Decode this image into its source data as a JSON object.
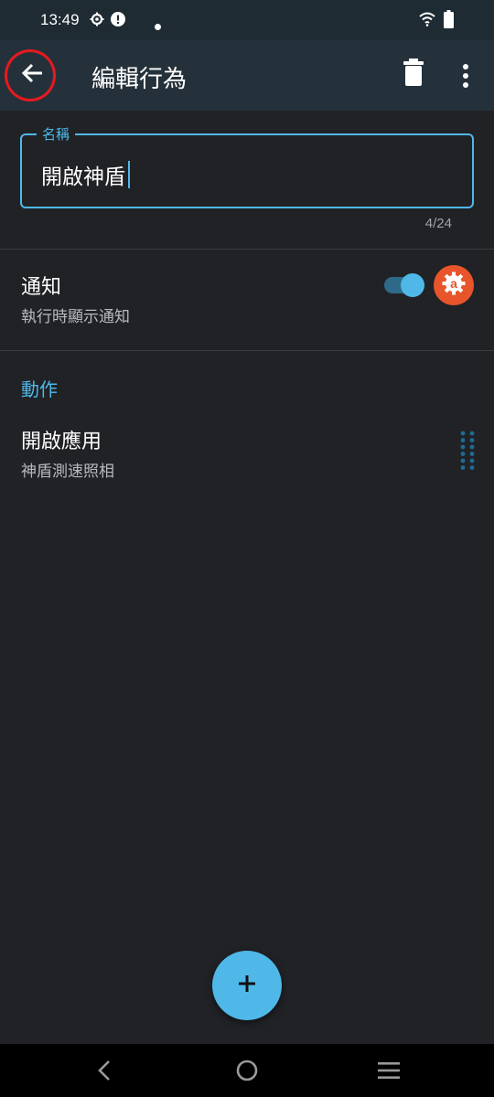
{
  "status_bar": {
    "time": "13:49",
    "icons": [
      "settings-gear-icon",
      "alert-icon",
      "dot-icon",
      "wifi-icon",
      "battery-icon"
    ]
  },
  "app_bar": {
    "title": "編輯行為",
    "icons": [
      "back-arrow-icon",
      "delete-icon",
      "more-vert-icon"
    ]
  },
  "name_field": {
    "label": "名稱",
    "value": "開啟神盾",
    "counter": "4/24"
  },
  "notification": {
    "title": "通知",
    "subtitle": "執行時顯示通知",
    "enabled": true,
    "badge_icon": "automation-a-icon"
  },
  "actions_section": {
    "heading": "動作",
    "items": [
      {
        "title": "開啟應用",
        "subtitle": "神盾測速照相",
        "handle_icon": "drag-handle-icon"
      }
    ]
  },
  "fab": {
    "icon": "plus-icon"
  },
  "nav_bar": {
    "icons": [
      "nav-back-icon",
      "nav-home-icon",
      "nav-recents-icon"
    ]
  },
  "colors": {
    "accent": "#4fb8e8",
    "app_bar": "#25313a",
    "background": "#212226",
    "badge": "#e8552a",
    "highlight": "#e81920"
  }
}
